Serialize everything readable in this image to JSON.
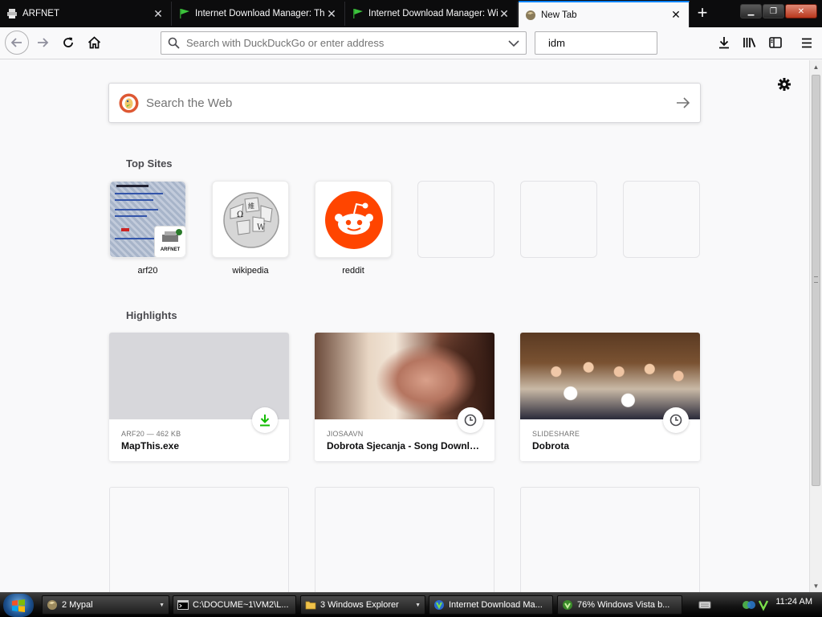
{
  "tabs": [
    {
      "title": "ARFNET",
      "icon": "printer-icon"
    },
    {
      "title": "Internet Download Manager: The",
      "icon": "green-flag-icon"
    },
    {
      "title": "Internet Download Manager: Wi",
      "icon": "green-flag-icon"
    },
    {
      "title": "New Tab",
      "icon": "firefox-icon",
      "active": true
    }
  ],
  "navbar": {
    "url_placeholder": "Search with DuckDuckGo or enter address",
    "search_value": "idm"
  },
  "newtab": {
    "web_search_placeholder": "Search the Web",
    "top_sites_title": "Top Sites",
    "top_sites": [
      {
        "label": "arf20",
        "type": "screenshot"
      },
      {
        "label": "wikipedia",
        "type": "logo"
      },
      {
        "label": "reddit",
        "type": "logo"
      },
      {
        "label": "",
        "type": "empty"
      },
      {
        "label": "",
        "type": "empty"
      },
      {
        "label": "",
        "type": "empty"
      }
    ],
    "highlights_title": "Highlights",
    "highlights": [
      {
        "context": "ARF20 — 462 KB",
        "title": "MapThis.exe",
        "badge": "download-icon"
      },
      {
        "context": "JIOSAAVN",
        "title": "Dobrota Sjecanja - Song Download from Dob...",
        "badge": "clock-icon"
      },
      {
        "context": "SLIDESHARE",
        "title": "Dobrota",
        "badge": "clock-icon"
      }
    ]
  },
  "taskbar": {
    "items": [
      {
        "label": "2 Mypal",
        "icon": "mypal-icon",
        "group": true
      },
      {
        "label": "C:\\DOCUME~1\\VM2\\L...",
        "icon": "cmd-icon",
        "group": false
      },
      {
        "label": "3 Windows Explorer",
        "icon": "folder-icon",
        "group": true
      },
      {
        "label": "Internet Download Ma...",
        "icon": "idm-icon",
        "group": false
      },
      {
        "label": "76% Windows Vista b...",
        "icon": "idm-progress-icon",
        "group": false
      }
    ],
    "clock": "11:24 AM"
  },
  "colors": {
    "accent": "#0a84ff",
    "reddit": "#ff4500",
    "download": "#12bc00",
    "tab_strip": "#0c0c0d"
  }
}
